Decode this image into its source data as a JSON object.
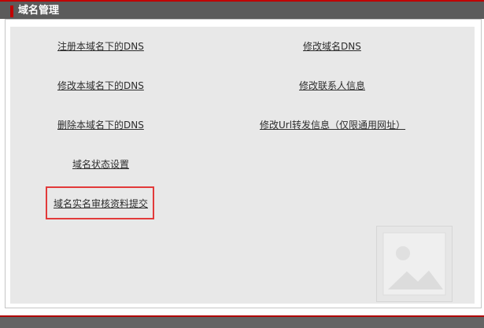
{
  "header": {
    "title": "域名管理"
  },
  "links": {
    "register_dns": "注册本域名下的DNS",
    "modify_domain_dns": "修改域名DNS",
    "modify_dns": "修改本域名下的DNS",
    "modify_contact": "修改联系人信息",
    "delete_dns": "删除本域名下的DNS",
    "modify_url_forward": "修改Url转发信息（仅限通用网址）",
    "domain_status": "域名状态设置",
    "realname_submit": "域名实名审核资料提交"
  },
  "colors": {
    "accent": "#c00000",
    "highlight": "#e23a3a",
    "bar": "#5b5b5b",
    "panel": "#e8e8e8"
  },
  "icons": {
    "placeholder": "image-placeholder-icon"
  }
}
